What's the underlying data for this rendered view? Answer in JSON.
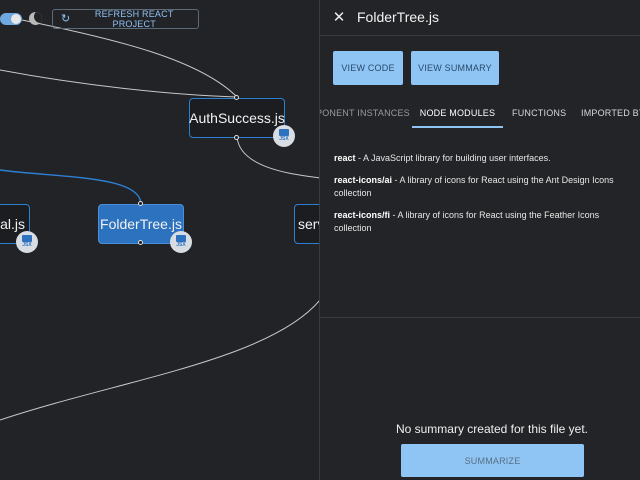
{
  "toolbar": {
    "refresh_label": "REFRESH REACT PROJECT",
    "refresh_icon": "refresh-icon",
    "theme_toggle_icon": "toggle-switch",
    "theme_icon": "moon-icon"
  },
  "graph": {
    "nodes": {
      "auth": {
        "label": "AuthSuccess.js",
        "badge": "JSX"
      },
      "folder": {
        "label": "FolderTree.js",
        "badge": "JSX"
      },
      "left": {
        "label": "al.js",
        "badge": "JSX"
      },
      "right": {
        "label": "serv"
      }
    },
    "colors": {
      "node_border": "#2d7fd1",
      "active_node": "#2d72bf",
      "edge": "#c8c8c8"
    }
  },
  "panel": {
    "title": "FolderTree.js",
    "close_icon": "close-icon",
    "view_code_label": "VIEW CODE",
    "view_summary_label": "VIEW SUMMARY",
    "tabs": [
      {
        "label": "PONENT INSTANCES"
      },
      {
        "label": "NODE MODULES"
      },
      {
        "label": "FUNCTIONS"
      },
      {
        "label": "IMPORTED BY"
      }
    ],
    "modules": [
      {
        "name": "react",
        "desc": " - A JavaScript library for building user interfaces."
      },
      {
        "name": "react-icons/ai",
        "desc": " - A library of icons for React using the Ant Design Icons collection"
      },
      {
        "name": "react-icons/fi",
        "desc": " - A library of icons for React using the Feather Icons collection"
      }
    ],
    "summary_message": "No summary created for this file yet.",
    "summarize_label": "SUMMARIZE",
    "accent_color": "#8ec5f5"
  }
}
